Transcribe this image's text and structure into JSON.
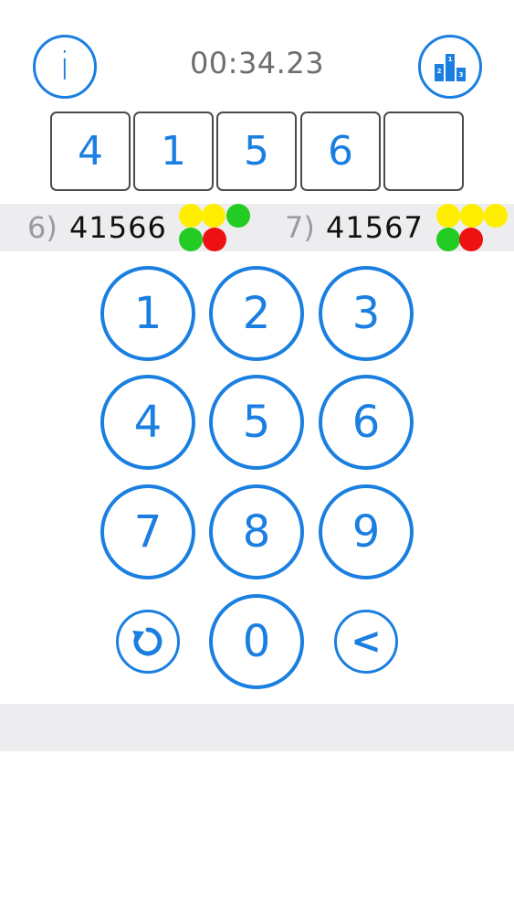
{
  "header": {
    "info_label": "i",
    "timer": "00:34.23"
  },
  "input": {
    "digits": [
      "4",
      "1",
      "5",
      "6",
      ""
    ]
  },
  "history": [
    {
      "index": "6)",
      "guess": "41566",
      "pegs": [
        "yellow",
        "yellow",
        "green",
        "green",
        "red"
      ]
    },
    {
      "index": "7)",
      "guess": "41567",
      "pegs": [
        "yellow",
        "yellow",
        "yellow",
        "green",
        "red"
      ]
    }
  ],
  "keypad": {
    "keys": [
      "1",
      "2",
      "3",
      "4",
      "5",
      "6",
      "7",
      "8",
      "9",
      "0"
    ],
    "backspace_label": "<"
  },
  "colors": {
    "accent": "#1a7fe0",
    "peg_yellow": "#ffee00",
    "peg_green": "#22cc22",
    "peg_red": "#ee1111",
    "strip": "#ededf0"
  },
  "icons": {
    "info": "info-icon",
    "leaderboard": "podium-icon",
    "reset": "refresh-icon"
  }
}
